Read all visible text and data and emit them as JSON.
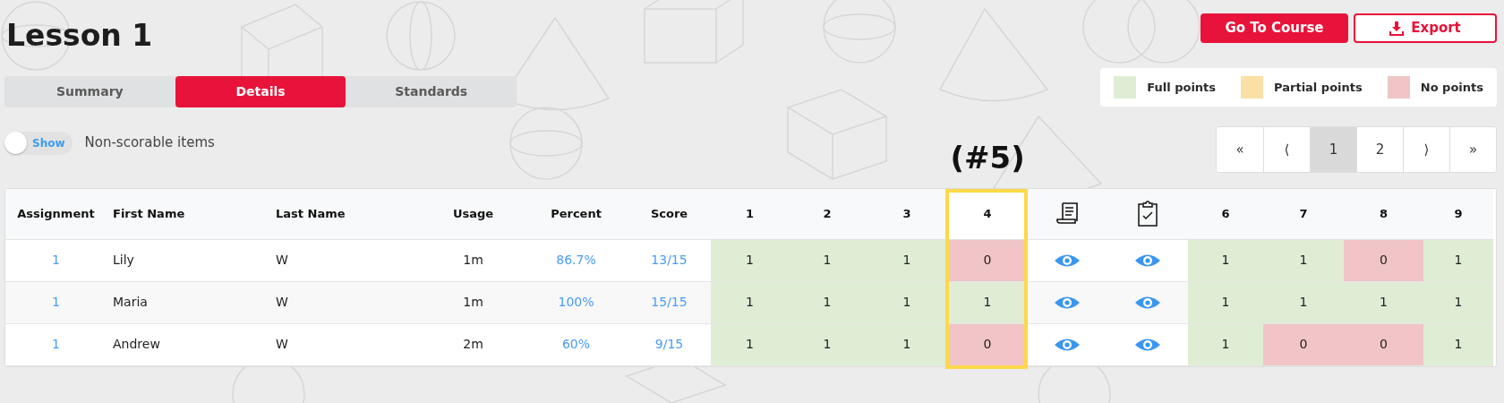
{
  "title": "Lesson 1",
  "tabs": [
    {
      "label": "Summary",
      "selected": false
    },
    {
      "label": "Details",
      "selected": true
    },
    {
      "label": "Standards",
      "selected": false
    }
  ],
  "toggle": {
    "label": "Show",
    "on": false,
    "text": "Non-scorable items"
  },
  "buttons": [
    {
      "label": "Go To Course",
      "kind": "primary"
    },
    {
      "label": "Export",
      "kind": "export"
    }
  ],
  "legend": [
    {
      "label": "Full points",
      "color": "#e0edd5"
    },
    {
      "label": "Partial points",
      "color": "#fadfa6"
    },
    {
      "label": "No points",
      "color": "#f1c5c7"
    }
  ],
  "pagination": [
    {
      "label": "«",
      "selected": false
    },
    {
      "label": "⟨",
      "selected": false
    },
    {
      "label": "1",
      "selected": true
    },
    {
      "label": "2",
      "selected": false
    },
    {
      "label": "⟩",
      "selected": false
    },
    {
      "label": "»",
      "selected": false
    }
  ],
  "annotation": "(#5)",
  "table": {
    "columns": [
      {
        "label": "Assignment",
        "kind": "text",
        "highlighted": false
      },
      {
        "label": "First Name",
        "kind": "text",
        "highlighted": false
      },
      {
        "label": "Last Name",
        "kind": "text",
        "highlighted": false
      },
      {
        "label": "Usage",
        "kind": "text",
        "highlighted": false
      },
      {
        "label": "Percent",
        "kind": "text",
        "highlighted": false
      },
      {
        "label": "Score",
        "kind": "text",
        "highlighted": false
      },
      {
        "label": "1",
        "kind": "text",
        "highlighted": false
      },
      {
        "label": "2",
        "kind": "text",
        "highlighted": false
      },
      {
        "label": "3",
        "kind": "text",
        "highlighted": false
      },
      {
        "label": "4",
        "kind": "text",
        "highlighted": true
      },
      {
        "kind": "scroll",
        "highlighted": false
      },
      {
        "kind": "clipboard",
        "highlighted": false
      },
      {
        "label": "6",
        "kind": "text",
        "highlighted": false
      },
      {
        "label": "7",
        "kind": "text",
        "highlighted": false
      },
      {
        "label": "8",
        "kind": "text",
        "highlighted": false
      },
      {
        "label": "9",
        "kind": "text",
        "highlighted": false
      }
    ],
    "rows": [
      {
        "assignment": "1",
        "first_name": "Lily",
        "last_name": "W",
        "usage": "1m",
        "percent": "86.7%",
        "score": "13/15",
        "items": [
          {
            "kind": "score",
            "value": "1",
            "color": "#e0edd5"
          },
          {
            "kind": "score",
            "value": "1",
            "color": "#e0edd5"
          },
          {
            "kind": "score",
            "value": "1",
            "color": "#e0edd5"
          },
          {
            "kind": "score",
            "value": "0",
            "color": "#f1c5c7"
          },
          {
            "kind": "view"
          },
          {
            "kind": "view"
          },
          {
            "kind": "score",
            "value": "1",
            "color": "#e0edd5"
          },
          {
            "kind": "score",
            "value": "1",
            "color": "#e0edd5"
          },
          {
            "kind": "score",
            "value": "0",
            "color": "#f1c5c7"
          },
          {
            "kind": "score",
            "value": "1",
            "color": "#e0edd5"
          }
        ]
      },
      {
        "assignment": "1",
        "first_name": "Maria",
        "last_name": "W",
        "usage": "1m",
        "percent": "100%",
        "score": "15/15",
        "items": [
          {
            "kind": "score",
            "value": "1",
            "color": "#e0edd5"
          },
          {
            "kind": "score",
            "value": "1",
            "color": "#e0edd5"
          },
          {
            "kind": "score",
            "value": "1",
            "color": "#e0edd5"
          },
          {
            "kind": "score",
            "value": "1",
            "color": "#e0edd5"
          },
          {
            "kind": "view"
          },
          {
            "kind": "view"
          },
          {
            "kind": "score",
            "value": "1",
            "color": "#e0edd5"
          },
          {
            "kind": "score",
            "value": "1",
            "color": "#e0edd5"
          },
          {
            "kind": "score",
            "value": "1",
            "color": "#e0edd5"
          },
          {
            "kind": "score",
            "value": "1",
            "color": "#e0edd5"
          }
        ]
      },
      {
        "assignment": "1",
        "first_name": "Andrew",
        "last_name": "W",
        "usage": "2m",
        "percent": "60%",
        "score": "9/15",
        "items": [
          {
            "kind": "score",
            "value": "1",
            "color": "#e0edd5"
          },
          {
            "kind": "score",
            "value": "1",
            "color": "#e0edd5"
          },
          {
            "kind": "score",
            "value": "1",
            "color": "#e0edd5"
          },
          {
            "kind": "score",
            "value": "0",
            "color": "#f1c5c7"
          },
          {
            "kind": "view"
          },
          {
            "kind": "view"
          },
          {
            "kind": "score",
            "value": "1",
            "color": "#e0edd5"
          },
          {
            "kind": "score",
            "value": "0",
            "color": "#f1c5c7"
          },
          {
            "kind": "score",
            "value": "0",
            "color": "#f1c5c7"
          },
          {
            "kind": "score",
            "value": "1",
            "color": "#e0edd5"
          }
        ]
      }
    ]
  }
}
